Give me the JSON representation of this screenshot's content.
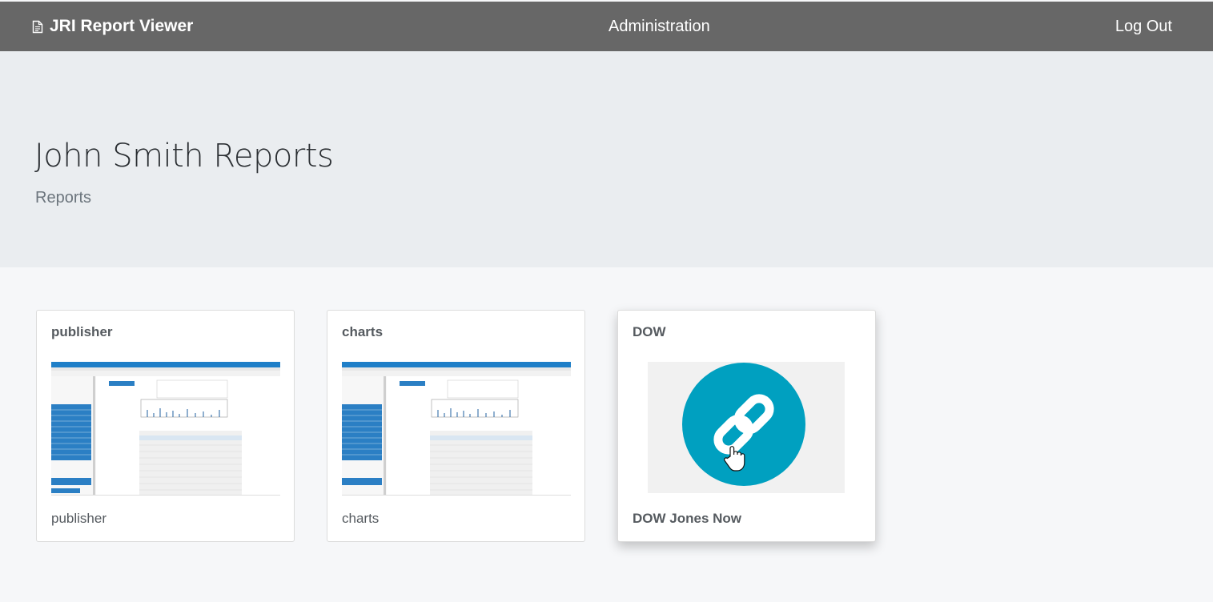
{
  "nav": {
    "brand": "JRI Report Viewer",
    "admin": "Administration",
    "logout": "Log Out"
  },
  "header": {
    "title": "John Smith Reports",
    "subtitle": "Reports"
  },
  "cards": [
    {
      "title": "publisher",
      "label": "publisher",
      "icon": "report-preview-thumbnail"
    },
    {
      "title": "charts",
      "label": "charts",
      "icon": "report-preview-thumbnail"
    },
    {
      "title": "DOW",
      "label": "DOW Jones Now",
      "icon": "link-icon"
    }
  ],
  "colors": {
    "navbar": "#676767",
    "jumbotron": "#eaedf0",
    "link_circle": "#00a0c0"
  }
}
